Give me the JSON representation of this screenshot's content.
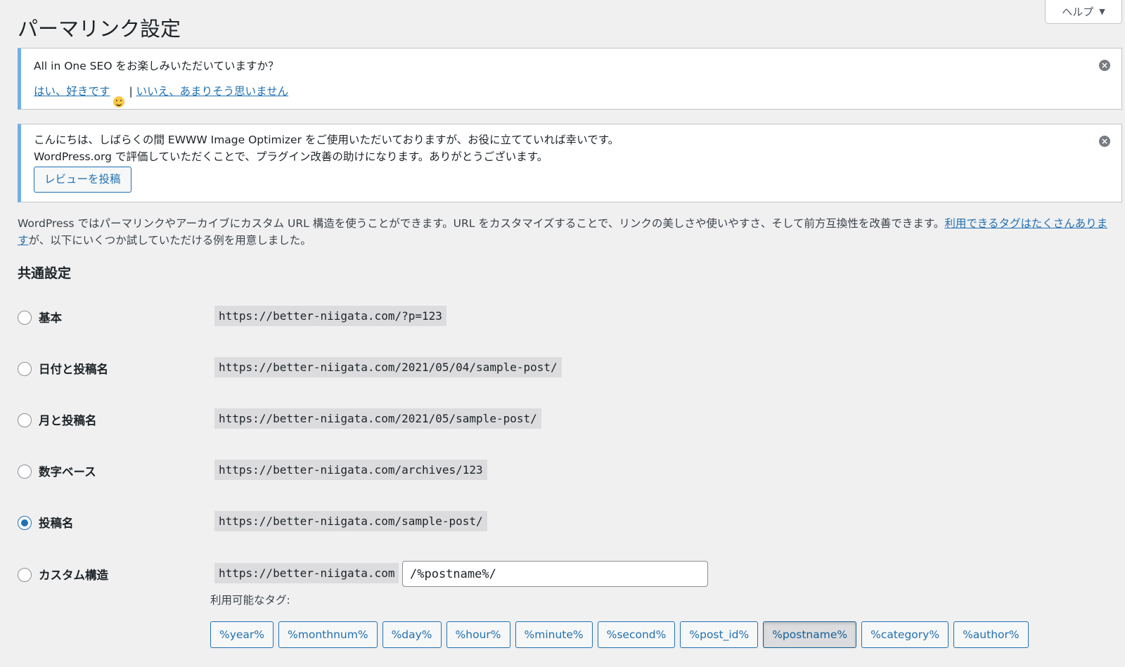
{
  "help_tab": {
    "label": "ヘルプ",
    "caret": "▼"
  },
  "page_title": "パーマリンク設定",
  "notice_seo": {
    "text": "All in One SEO をお楽しみいただいていますか？",
    "yes_link": "はい、好きです",
    "separator": "|",
    "no_link": "いいえ、あまりそう思いません",
    "dismiss_icon": "close-circle-icon"
  },
  "notice_ewww": {
    "line1": "こんにちは、しばらくの間 EWWW Image Optimizer をご使用いただいておりますが、お役に立てていれば幸いです。",
    "line2": "WordPress.org で評価していただくことで、プラグイン改善の助けになります。ありがとうございます。",
    "review_button": "レビューを投稿",
    "dismiss_icon": "close-circle-icon"
  },
  "intro": {
    "text_before": "WordPress ではパーマリンクやアーカイブにカスタム URL 構造を使うことができます。URL をカスタマイズすることで、リンクの美しさや使いやすさ、そして前方互換性を改善できます。",
    "link": "利用できるタグはたくさんあります",
    "text_after": "が、以下にいくつか試していただける例を用意しました。"
  },
  "section_title": "共通設定",
  "options": [
    {
      "label": "基本",
      "example": "https://better-niigata.com/?p=123",
      "checked": false
    },
    {
      "label": "日付と投稿名",
      "example": "https://better-niigata.com/2021/05/04/sample-post/",
      "checked": false
    },
    {
      "label": "月と投稿名",
      "example": "https://better-niigata.com/2021/05/sample-post/",
      "checked": false
    },
    {
      "label": "数字ベース",
      "example": "https://better-niigata.com/archives/123",
      "checked": false
    },
    {
      "label": "投稿名",
      "example": "https://better-niigata.com/sample-post/",
      "checked": true
    },
    {
      "label": "カスタム構造",
      "example": "https://better-niigata.com",
      "checked": false
    }
  ],
  "custom_structure_value": "/%postname%/",
  "tags_label": "利用可能なタグ:",
  "tags": [
    "%year%",
    "%monthnum%",
    "%day%",
    "%hour%",
    "%minute%",
    "%second%",
    "%post_id%",
    "%postname%",
    "%category%",
    "%author%"
  ],
  "active_tag": "%postname%",
  "colors": {
    "accent": "#2271b1",
    "notice_border": "#72aee6",
    "background": "#f0f0f1",
    "code_bg": "#dcdcde"
  }
}
